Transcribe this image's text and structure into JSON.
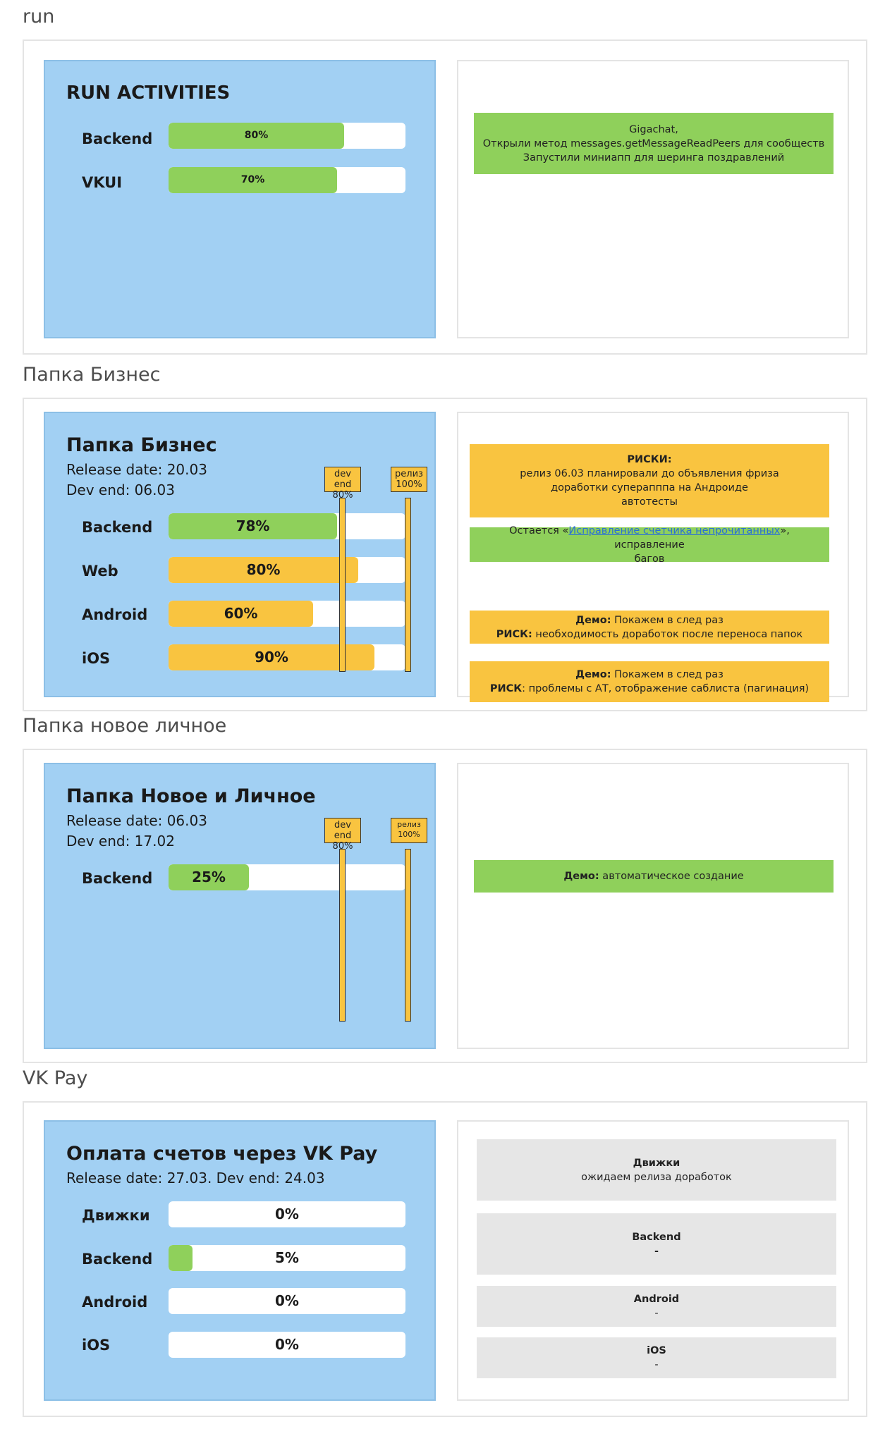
{
  "sections": [
    {
      "label": "run",
      "panel": {
        "title": "RUN ACTIVITIES",
        "rows": [
          {
            "label": "Backend",
            "percent_text": "80%",
            "progress": 0.74,
            "color": "#8fd05b"
          },
          {
            "label": "VKUI",
            "percent_text": "70%",
            "progress": 0.71,
            "color": "#8fd05b"
          }
        ]
      },
      "notes": [
        {
          "lines": [
            "Gigachat,",
            "Открыли метод messages.getMessageReadPeers для сообществ",
            "Запустили миниапп для шеринга поздравлений"
          ],
          "color": "#8fd05b"
        }
      ]
    },
    {
      "label": "Папка Бизнес",
      "panel": {
        "title": "Папка Бизнес",
        "release": "Release date: 20.03",
        "devend": "Dev end: 06.03",
        "markers": [
          {
            "line1": "dev end",
            "line2": "80%"
          },
          {
            "line1": "релиз",
            "line2": "100%"
          }
        ],
        "rows": [
          {
            "label": "Backend",
            "percent_text": "78%",
            "progress": 0.71,
            "color": "#8fd05b"
          },
          {
            "label": "Web",
            "percent_text": "80%",
            "progress": 0.8,
            "color": "#f9c440"
          },
          {
            "label": "Android",
            "percent_text": "60%",
            "progress": 0.61,
            "color": "#f9c440"
          },
          {
            "label": "iOS",
            "percent_text": "90%",
            "progress": 0.87,
            "color": "#f9c440"
          }
        ]
      },
      "notes": {
        "risks": {
          "heading": "РИСКИ:",
          "lines": [
            "релиз 06.03 планировали до объявления фриза",
            "доработки суперапппа на Андроиде",
            "автотесты"
          ]
        },
        "remaining": {
          "prefix": "Остается «",
          "link": "Исправление счетчика непрочитанных",
          "suffix": "», исправление",
          "line2": "багов"
        },
        "demo1": {
          "demo_label": "Демо:",
          "demo_text": " Покажем в след раз",
          "risk_label": "РИСК:",
          "risk_text": " необходимость доработок после переноса папок"
        },
        "demo2": {
          "demo_label": "Демо:",
          "demo_text": " Покажем в след раз",
          "risk_label": "РИСК",
          "risk_text": ": проблемы с АТ, отображение саблиста (пагинация)"
        }
      }
    },
    {
      "label": "Папка новое личное",
      "panel": {
        "title": "Папка Новое и Личное",
        "release": "Release date: 06.03",
        "devend": "Dev end: 17.02",
        "markers": [
          {
            "line1": "dev end",
            "line2": "80%"
          },
          {
            "line1": "релиз",
            "line2": "100%"
          }
        ],
        "rows": [
          {
            "label": "Backend",
            "percent_text": "25%",
            "progress": 0.34,
            "color": "#8fd05b"
          }
        ]
      },
      "notes": {
        "demo": {
          "label": "Демо:",
          "text": " автоматическое создание"
        }
      }
    },
    {
      "label": "VK Pay",
      "panel": {
        "title": "Оплата счетов через VK Pay",
        "release": "Release date: 27.03. Dev end: 24.03",
        "rows": [
          {
            "label": "Движки",
            "percent_text": "0%",
            "progress": 0,
            "color": "#8fd05b"
          },
          {
            "label": "Backend",
            "percent_text": "5%",
            "progress": 0.1,
            "color": "#8fd05b"
          },
          {
            "label": "Android",
            "percent_text": "0%",
            "progress": 0,
            "color": "#8fd05b"
          },
          {
            "label": "iOS",
            "percent_text": "0%",
            "progress": 0,
            "color": "#8fd05b"
          }
        ]
      },
      "notes": [
        {
          "heading": "Движки",
          "text": "ожидаем релиза доработок"
        },
        {
          "heading": "Backend",
          "text": "-"
        },
        {
          "heading": "Android",
          "text": "-"
        },
        {
          "heading": "iOS",
          "text": "-"
        }
      ]
    }
  ]
}
